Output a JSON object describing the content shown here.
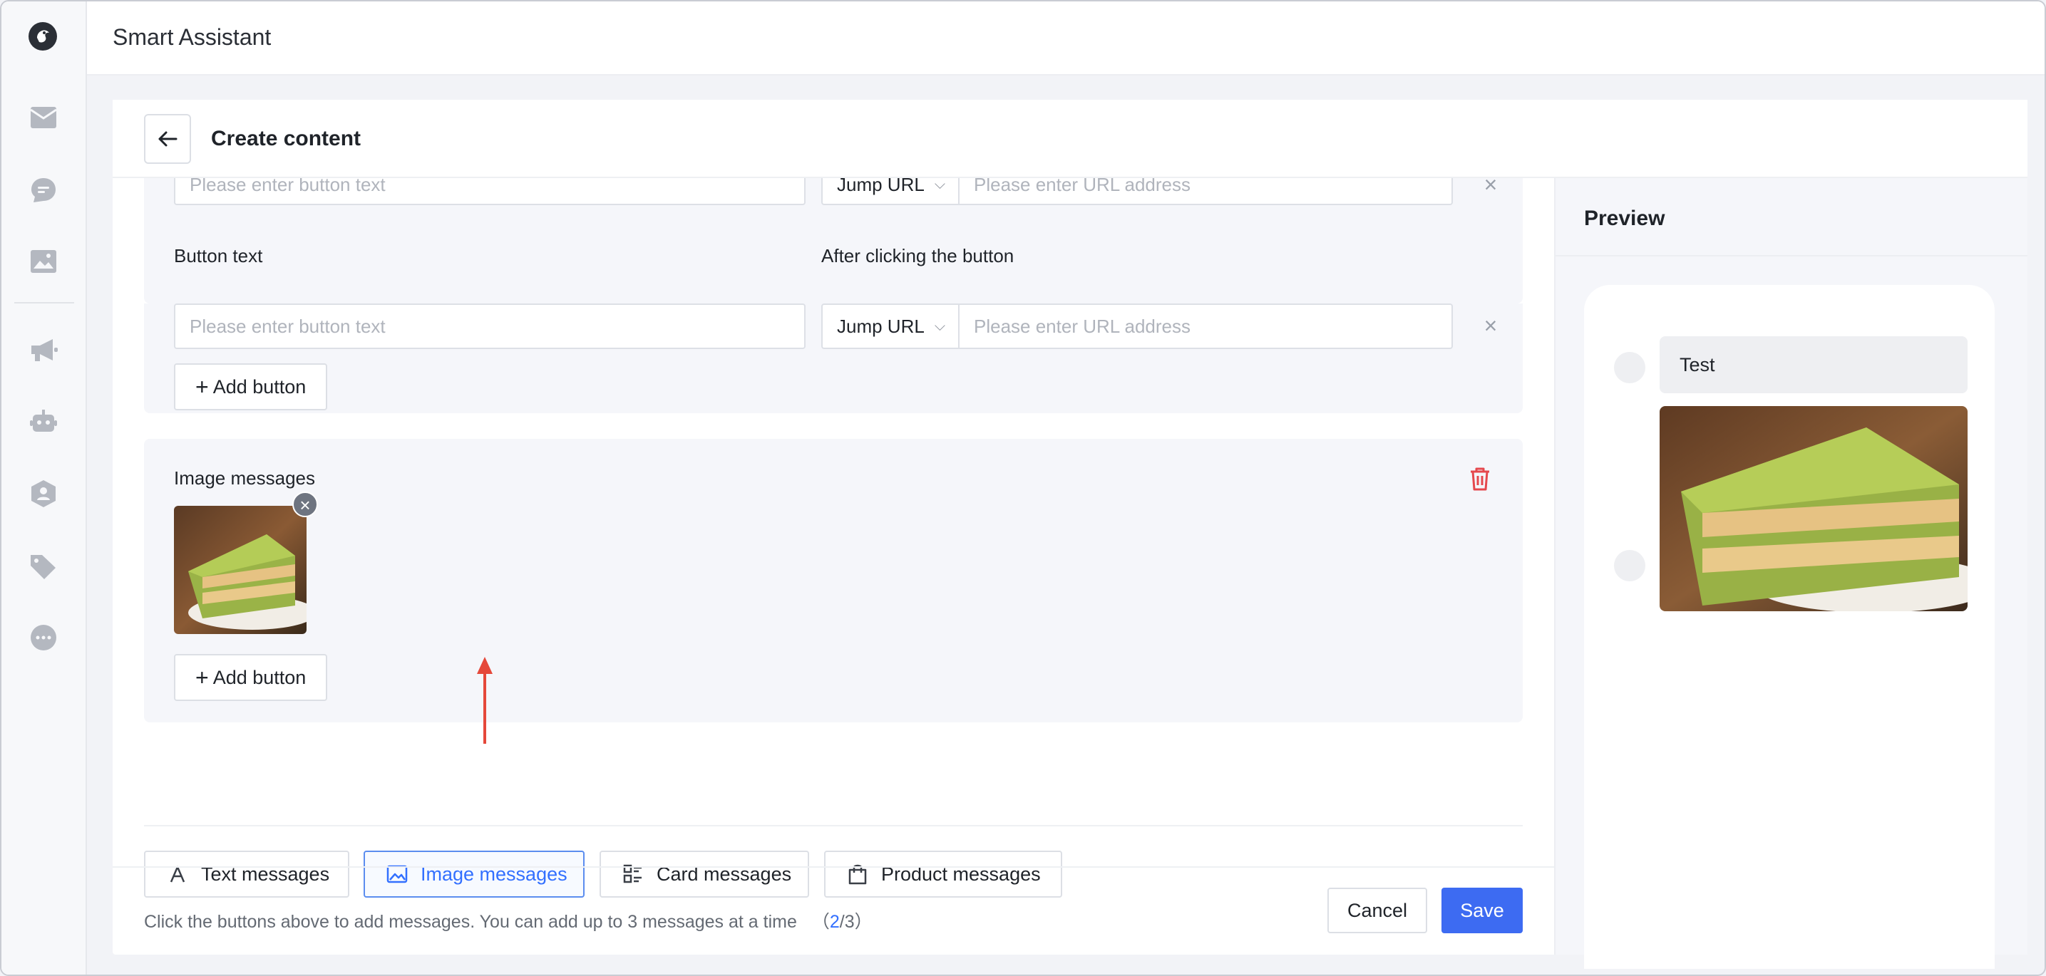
{
  "app": {
    "title": "Smart Assistant"
  },
  "sidebar": {
    "items": [
      {
        "name": "inbox-icon"
      },
      {
        "name": "chat-icon"
      },
      {
        "name": "image-icon"
      },
      {
        "name": "megaphone-icon"
      },
      {
        "name": "robot-icon"
      },
      {
        "name": "user-group-icon"
      },
      {
        "name": "tag-icon"
      },
      {
        "name": "more-icon"
      }
    ]
  },
  "header": {
    "title": "Create content"
  },
  "buttons_section": {
    "row1": {
      "text_placeholder": "Please enter button text",
      "action": "Jump URL",
      "url_placeholder": "Please enter URL address"
    },
    "row2": {
      "text_label": "Button text",
      "action_label": "After clicking the button",
      "text_placeholder": "Please enter button text",
      "action": "Jump URL",
      "url_placeholder": "Please enter URL address"
    },
    "add_button": "Add button"
  },
  "image_section": {
    "label": "Image messages",
    "add_button": "Add button"
  },
  "message_types": [
    {
      "label": "Text messages",
      "icon": "text-icon"
    },
    {
      "label": "Image messages",
      "icon": "picture-icon",
      "active": true
    },
    {
      "label": "Card messages",
      "icon": "card-list-icon"
    },
    {
      "label": "Product messages",
      "icon": "shopping-bag-icon"
    }
  ],
  "hint": {
    "text": "Click the buttons above to add messages. You can add up to 3 messages at a time",
    "open": "（",
    "current": "2",
    "sep": "/",
    "max": "3",
    "close": "）"
  },
  "footer": {
    "cancel": "Cancel",
    "save": "Save"
  },
  "preview": {
    "title": "Preview",
    "text_message": "Test"
  },
  "colors": {
    "primary": "#3d6bf2",
    "danger": "#e5484d",
    "arrow": "#e5483a"
  }
}
